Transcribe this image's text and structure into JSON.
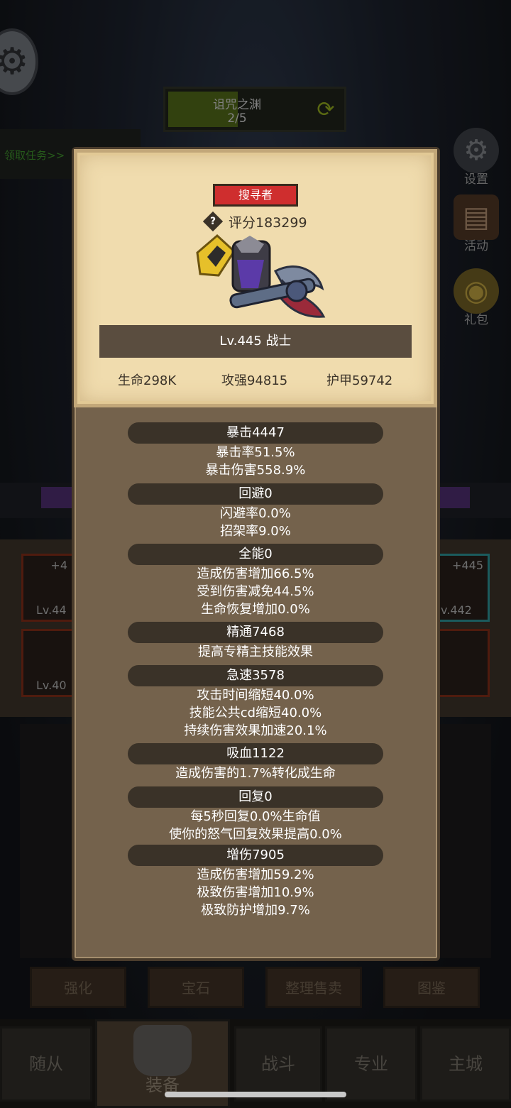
{
  "background": {
    "stage": {
      "title": "诅咒之渊",
      "progress": "2/5",
      "progress_fraction": 0.4
    },
    "quest_tab": "领取任务>>",
    "side_buttons": [
      {
        "icon": "gear-icon",
        "label": "设置"
      },
      {
        "icon": "scroll-icon",
        "label": "活动"
      },
      {
        "icon": "gift-icon",
        "label": "礼包"
      }
    ],
    "slots": [
      {
        "top": "+4",
        "bottom": "Lv.44"
      },
      {
        "top": "",
        "bottom": "Lv.40"
      },
      {
        "top": "+445",
        "bottom": "v.442"
      }
    ],
    "actions": [
      "强化",
      "宝石",
      "整理售卖",
      "图鉴"
    ],
    "nav": [
      "随从",
      "装备",
      "战斗",
      "专业",
      "主城"
    ]
  },
  "hero": {
    "title": "搜寻者",
    "score": "评分183299",
    "level": "Lv.445 战士",
    "hp": "生命298K",
    "atk": "攻强94815",
    "armor": "护甲59742"
  },
  "sections": [
    {
      "header": "暴击4447",
      "lines": [
        "暴击率51.5%",
        "暴击伤害558.9%"
      ]
    },
    {
      "header": "回避0",
      "lines": [
        "闪避率0.0%",
        "招架率9.0%"
      ]
    },
    {
      "header": "全能0",
      "lines": [
        "造成伤害增加66.5%",
        "受到伤害减免44.5%",
        "生命恢复增加0.0%"
      ]
    },
    {
      "header": "精通7468",
      "lines": [
        "提高专精主技能效果"
      ]
    },
    {
      "header": "急速3578",
      "lines": [
        "攻击时间缩短40.0%",
        "技能公共cd缩短40.0%",
        "持续伤害效果加速20.1%"
      ]
    },
    {
      "header": "吸血1122",
      "lines": [
        "造成伤害的1.7%转化成生命"
      ]
    },
    {
      "header": "回复0",
      "lines": [
        "每5秒回复0.0%生命值",
        "使你的怒气回复效果提高0.0%"
      ]
    },
    {
      "header": "增伤7905",
      "lines": [
        "造成伤害增加59.2%",
        "极致伤害增加10.9%",
        "极致防护增加9.7%"
      ]
    }
  ]
}
